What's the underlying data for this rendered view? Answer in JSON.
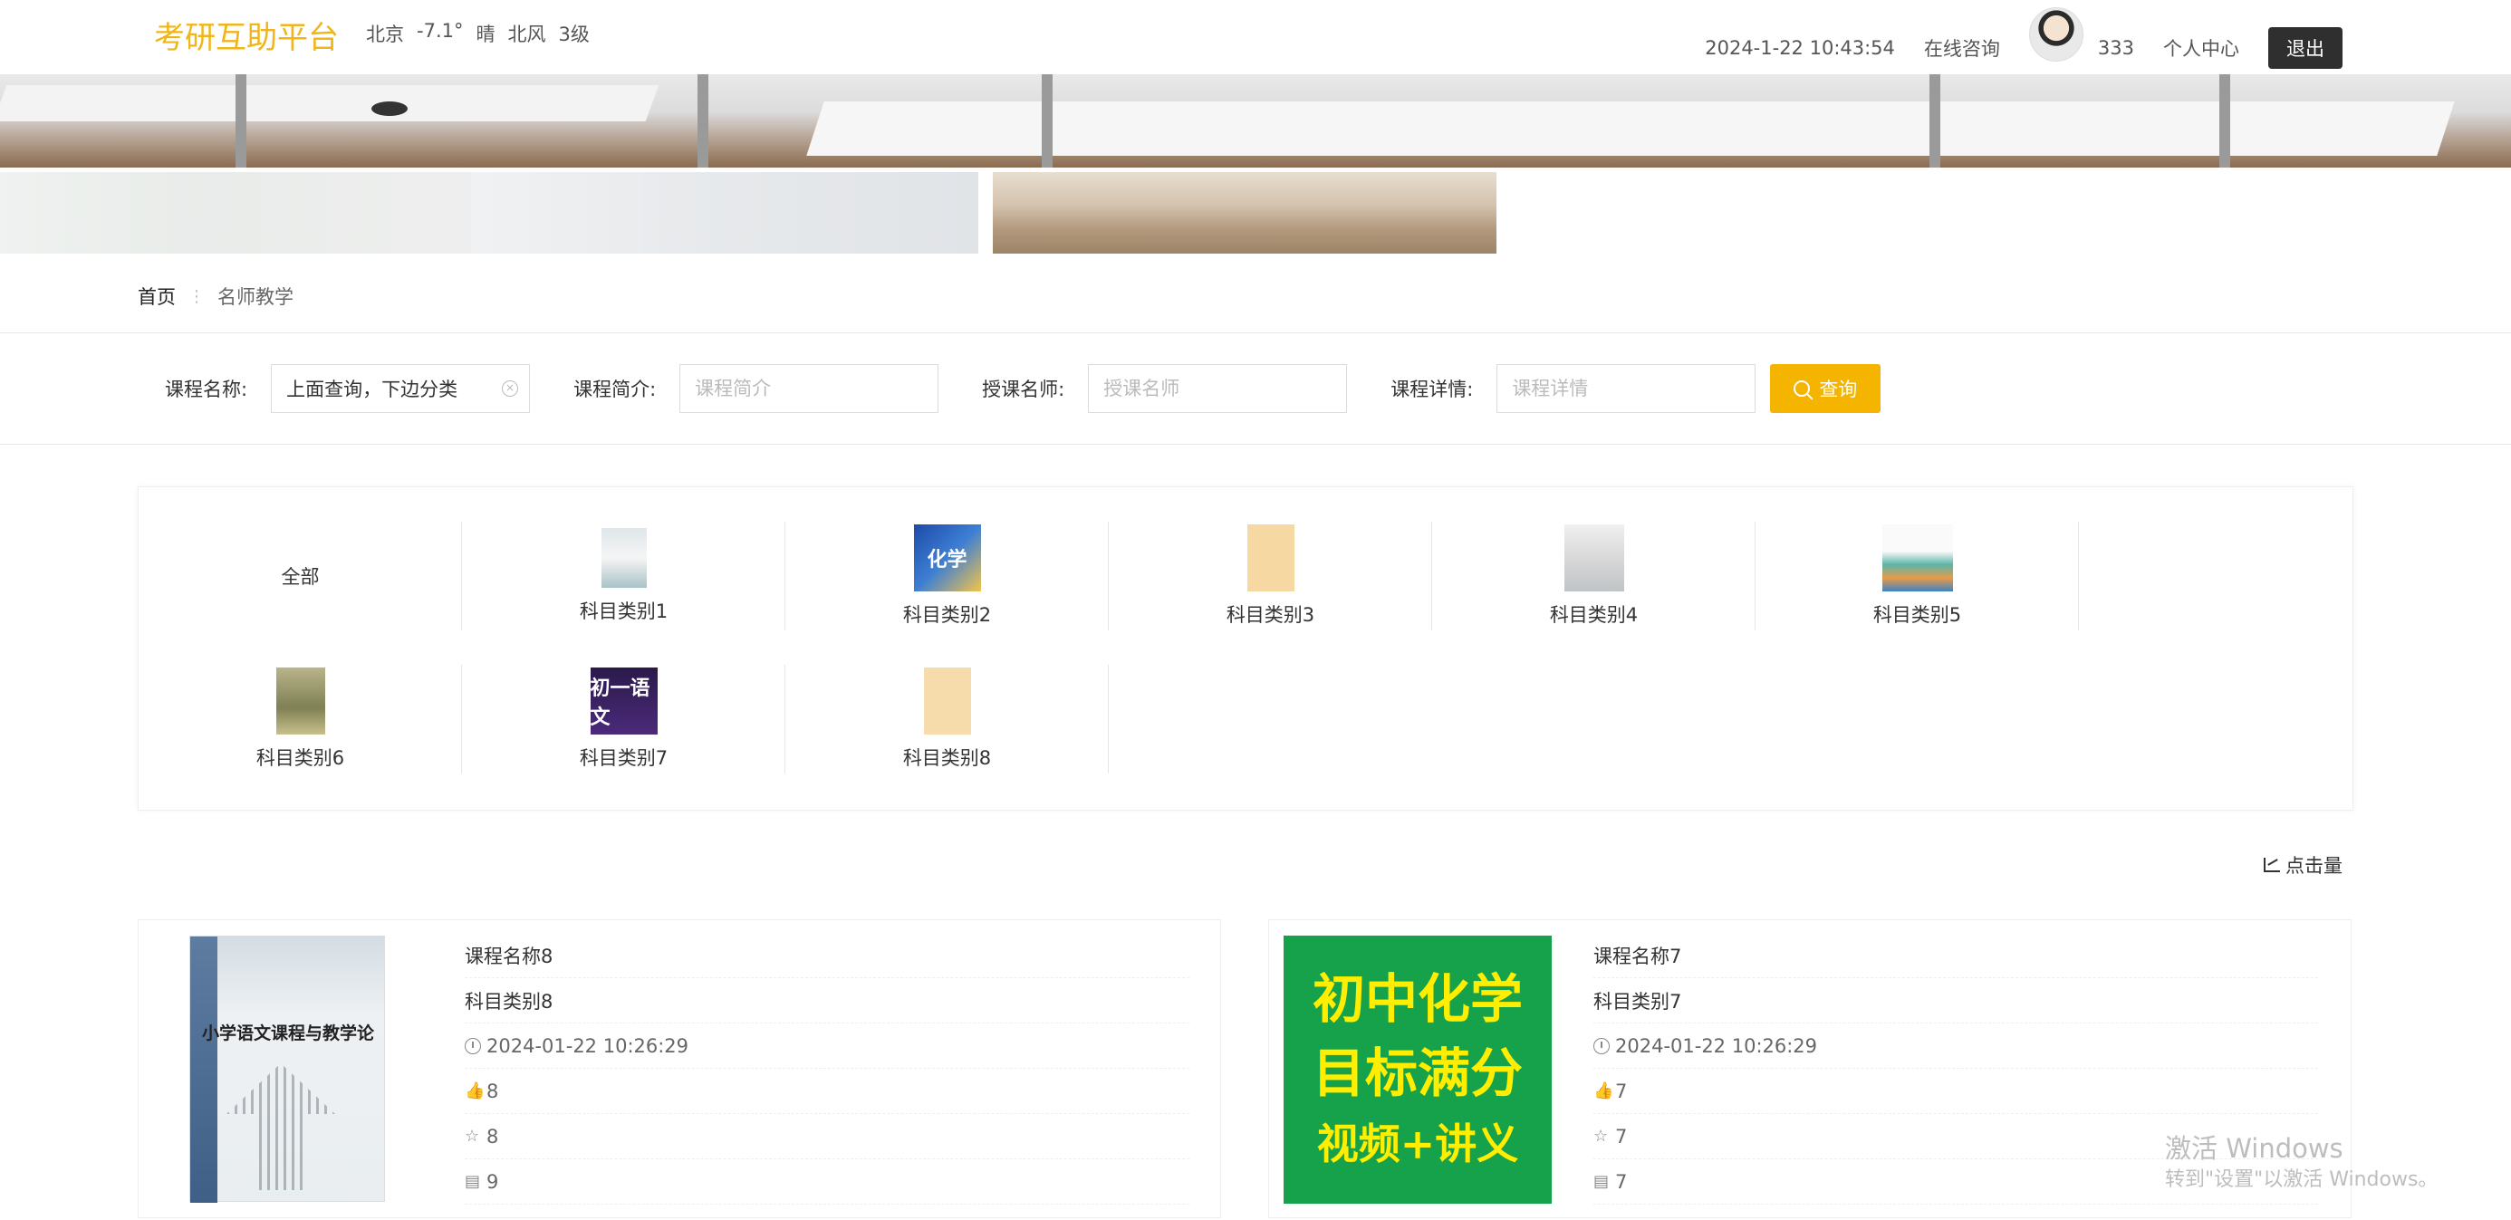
{
  "header": {
    "logo": "考研互助平台",
    "weather": {
      "city": "北京",
      "temp": "-7.1°",
      "condition": "晴",
      "wind": "北风",
      "level": "3级"
    },
    "datetime": "2024-1-22 10:43:54",
    "consult": "在线咨询",
    "username": "333",
    "center": "个人中心",
    "logout": "退出"
  },
  "breadcrumb": {
    "home": "首页",
    "separator": "⋮",
    "current": "名师教学"
  },
  "search": {
    "name_label": "课程名称:",
    "name_value": "上面查询，下边分类",
    "intro_label": "课程简介:",
    "intro_placeholder": "课程简介",
    "teacher_label": "授课名师:",
    "teacher_placeholder": "授课名师",
    "detail_label": "课程详情:",
    "detail_placeholder": "课程详情",
    "button": "查询"
  },
  "categories": [
    {
      "label": "全部",
      "cover": ""
    },
    {
      "label": "科目类别1",
      "cover": ""
    },
    {
      "label": "科目类别2",
      "cover": "化学"
    },
    {
      "label": "科目类别3",
      "cover": ""
    },
    {
      "label": "科目类别4",
      "cover": ""
    },
    {
      "label": "科目类别5",
      "cover": ""
    },
    {
      "label": "科目类别6",
      "cover": ""
    },
    {
      "label": "科目类别7",
      "cover": "初一语文"
    },
    {
      "label": "科目类别8",
      "cover": ""
    }
  ],
  "sort": {
    "label": "点击量"
  },
  "courses": [
    {
      "name": "课程名称8",
      "category": "科目类别8",
      "time": "2024-01-22 10:26:29",
      "likes": "8",
      "favorites": "8",
      "comments": "9",
      "cover_text": "小学语文课程与教学论"
    },
    {
      "name": "课程名称7",
      "category": "科目类别7",
      "time": "2024-01-22 10:26:29",
      "likes": "7",
      "favorites": "7",
      "comments": "7",
      "cover_lines": [
        "初中化学",
        "目标满分",
        "视频+讲义"
      ]
    }
  ],
  "watermark": {
    "line1": "激活 Windows",
    "line2": "转到\"设置\"以激活 Windows。"
  }
}
